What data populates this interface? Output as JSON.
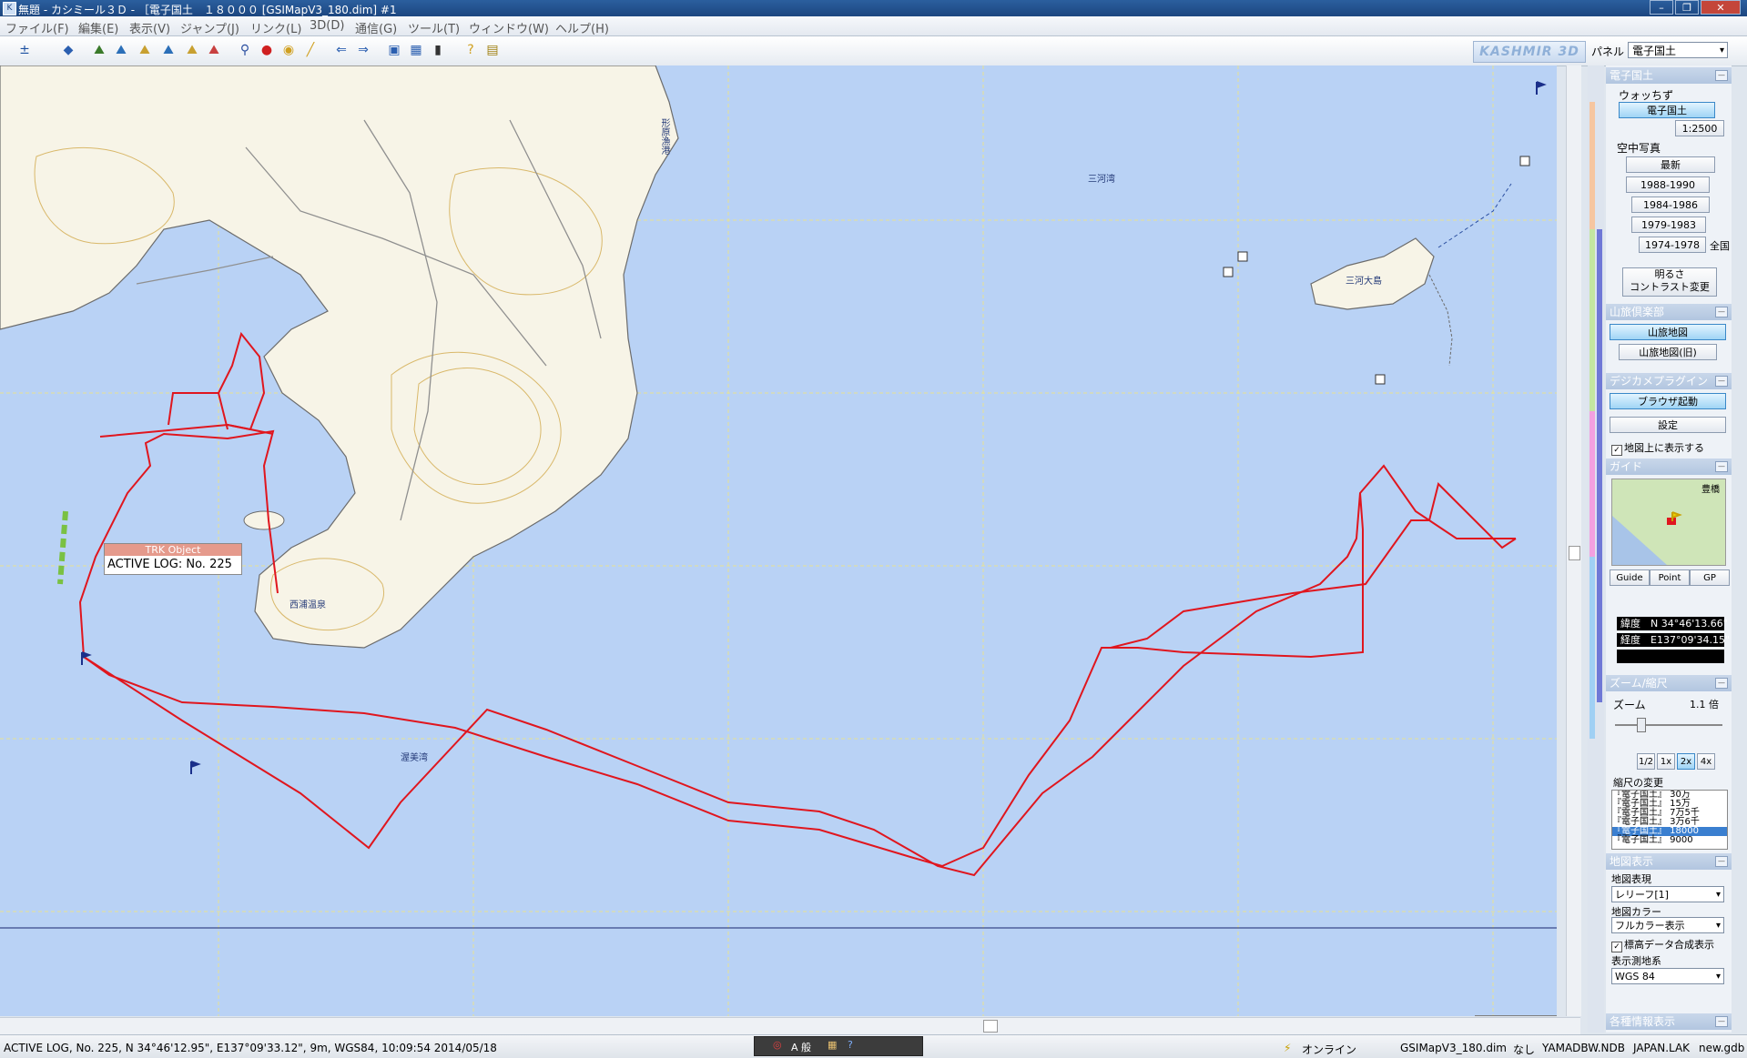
{
  "window": {
    "title": "無題 - カシミール３Ｄ - ［電子国土　１８０００ [GSIMapV3_180.dim] #1",
    "app_icon": "kashmir-app-icon",
    "controls": [
      "minimize-icon",
      "restore-icon",
      "close-icon"
    ]
  },
  "menu": [
    "ファイル(F)",
    "編集(E)",
    "表示(V)",
    "ジャンプ(J)",
    "リンク(L)",
    "3D(D)",
    "通信(G)",
    "ツール(T)",
    "ウィンドウ(W)",
    "ヘルプ(H)"
  ],
  "toolbar": {
    "icons": [
      "zoom-icon",
      "layer-icon",
      "cut-icon",
      "cut2-icon",
      "cut3-icon",
      "cut4-icon",
      "cut5-icon",
      "cut6-icon",
      "binoculars-icon",
      "pins-icon",
      "tag-icon",
      "ruler-icon",
      "back-icon",
      "forward-icon",
      "camera-icon",
      "film-icon",
      "gps-icon",
      "help-icon",
      "guide-icon"
    ],
    "logo": "KASHMIR 3D",
    "panel_label": "パネル",
    "panel_value": "電子国土"
  },
  "map": {
    "labels": {
      "bay": "渥美湾",
      "mikawa_island": "三河大島",
      "mikawa_anchor": "三河湾",
      "harbor": "形原漁港",
      "town": "西浦温泉"
    },
    "tooltip": {
      "header": "TRK Object",
      "text": "ACTIVE LOG: No. 225"
    },
    "scale_ticks": [
      "100",
      "200",
      "300"
    ],
    "colors": {
      "sea": "#b9d2f5",
      "land": "#f7f4e7",
      "track": "#e0161e",
      "grid": "#e8e394"
    }
  },
  "panel": {
    "denshi": {
      "title": "電子国土",
      "watchizu": "ウォッちず",
      "btn_denshi": "電子国土",
      "btn_scale": "1:2500",
      "aerial": "空中写真",
      "btn_latest": "最新",
      "years": [
        "1988-1990",
        "1984-1986",
        "1979-1983",
        "1974-1978"
      ],
      "all": "全国",
      "btn_bright": "明るさ",
      "btn_contrast": "コントラスト変更"
    },
    "sanryo": {
      "title": "山旅倶楽部",
      "btn_map": "山旅地図",
      "btn_old": "山旅地図(旧)"
    },
    "dejicame": {
      "title": "デジカメプラグイン",
      "btn_browser": "ブラウザ起動",
      "btn_settings": "設定",
      "chk_show": "地図上に表示する"
    },
    "guide": {
      "title": "ガイド",
      "place": "豊橋",
      "tabs": [
        "Guide",
        "Point",
        "GP"
      ],
      "lat": "緯度　N 34°46'13.66\"",
      "lon": "経度　E137°09'34.15\""
    },
    "zoom": {
      "title": "ズーム/縮尺",
      "zoom_label": "ズーム",
      "zoom_value": "1.1 倍",
      "btns": [
        "1/2",
        "1x",
        "2x",
        "4x"
      ],
      "scale_change": "縮尺の変更",
      "scale_list": [
        "『電子国土』 30万",
        "『電子国土』 15万",
        "『電子国土』 7万5千",
        "『電子国土』 3万6千",
        "『電子国土』 18000",
        "『電子国土』 9000"
      ]
    },
    "display": {
      "title": "地図表示",
      "expression_label": "地図表現",
      "expression_value": "レリーフ[1]",
      "color_label": "地図カラー",
      "color_value": "フルカラー表示",
      "chk_elev": "標高データ合成表示",
      "datum_label": "表示測地系",
      "datum_value": "WGS 84"
    },
    "info": {
      "title": "各種情報表示"
    }
  },
  "status": {
    "log": "ACTIVE LOG, No. 225, N 34°46'12.95\", E137°09'33.12\", 9m, WGS84, 10:09:54 2014/05/18",
    "ime_mode": "A 般",
    "online": "オンライン",
    "file": "GSIMapV3_180.dim",
    "none": "なし",
    "db1": "YAMADBW.NDB",
    "db2": "JAPAN.LAK",
    "new": "new.gdb"
  }
}
